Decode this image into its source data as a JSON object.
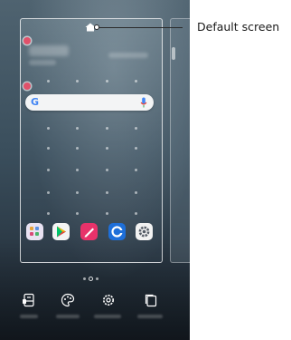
{
  "callout": {
    "label": "Default screen"
  },
  "search": {
    "logo": "G"
  },
  "dock": {
    "apps": [
      {
        "name": "app-folder-icon",
        "color": "#e9e2f2"
      },
      {
        "name": "play-store-icon",
        "color": "#f4f4f4"
      },
      {
        "name": "notes-icon",
        "color": "#e8326a"
      },
      {
        "name": "browser-icon",
        "color": "#1e6fd9"
      },
      {
        "name": "settings-icon",
        "color": "#f2f2f2"
      }
    ]
  },
  "bottom_bar": {
    "items": [
      {
        "name": "widgets-icon"
      },
      {
        "name": "theme-icon"
      },
      {
        "name": "home-settings-icon"
      },
      {
        "name": "wallpaper-icon"
      }
    ]
  },
  "colors": {
    "remove_badge": "#e0516a",
    "wallpaper_top": "#4f6370",
    "wallpaper_bottom": "#1e2833"
  }
}
